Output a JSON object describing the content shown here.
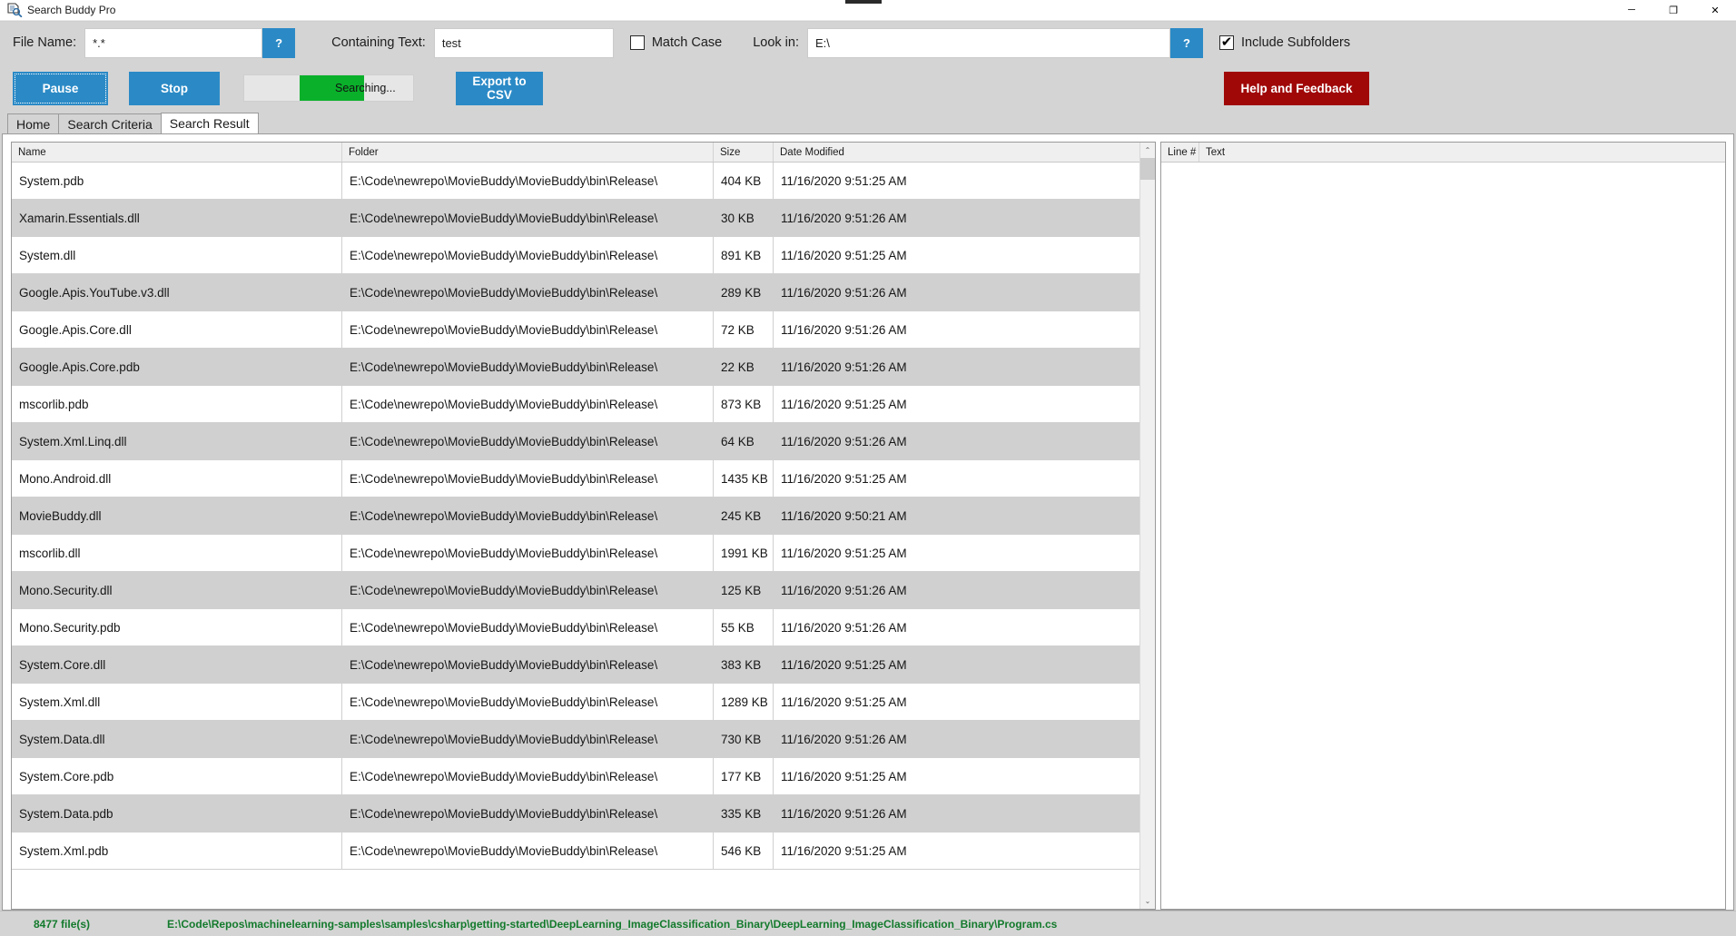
{
  "window": {
    "title": "Search Buddy Pro",
    "icon": "document-search-icon",
    "minimize_label": "─",
    "restore_label": "❐",
    "close_label": "✕"
  },
  "criteria": {
    "file_name_label": "File Name:",
    "file_name_value": "*.*",
    "file_name_help": "?",
    "containing_text_label": "Containing Text:",
    "containing_text_value": "test",
    "match_case_label": "Match Case",
    "match_case_checked": false,
    "look_in_label": "Look in:",
    "look_in_value": "E:\\",
    "look_in_help": "?",
    "include_subfolders_label": "Include Subfolders",
    "include_subfolders_checked": true,
    "checkmark": "✔"
  },
  "actions": {
    "pause_label": "Pause",
    "stop_label": "Stop",
    "export_label": "Export to CSV",
    "help_label": "Help and Feedback",
    "progress_text": "Searching...",
    "progress_percent": 38
  },
  "tabs": [
    {
      "label": "Home",
      "active": false
    },
    {
      "label": "Search Criteria",
      "active": false
    },
    {
      "label": "Search Result",
      "active": true
    }
  ],
  "results": {
    "columns": [
      "Name",
      "Folder",
      "Size",
      "Date Modified"
    ],
    "rows": [
      {
        "name": "System.pdb",
        "folder": "E:\\Code\\newrepo\\MovieBuddy\\MovieBuddy\\bin\\Release\\",
        "size": "404 KB",
        "date": "11/16/2020 9:51:25 AM"
      },
      {
        "name": "Xamarin.Essentials.dll",
        "folder": "E:\\Code\\newrepo\\MovieBuddy\\MovieBuddy\\bin\\Release\\",
        "size": "30 KB",
        "date": "11/16/2020 9:51:26 AM"
      },
      {
        "name": "System.dll",
        "folder": "E:\\Code\\newrepo\\MovieBuddy\\MovieBuddy\\bin\\Release\\",
        "size": "891 KB",
        "date": "11/16/2020 9:51:25 AM"
      },
      {
        "name": "Google.Apis.YouTube.v3.dll",
        "folder": "E:\\Code\\newrepo\\MovieBuddy\\MovieBuddy\\bin\\Release\\",
        "size": "289 KB",
        "date": "11/16/2020 9:51:26 AM"
      },
      {
        "name": "Google.Apis.Core.dll",
        "folder": "E:\\Code\\newrepo\\MovieBuddy\\MovieBuddy\\bin\\Release\\",
        "size": "72 KB",
        "date": "11/16/2020 9:51:26 AM"
      },
      {
        "name": "Google.Apis.Core.pdb",
        "folder": "E:\\Code\\newrepo\\MovieBuddy\\MovieBuddy\\bin\\Release\\",
        "size": "22 KB",
        "date": "11/16/2020 9:51:26 AM"
      },
      {
        "name": "mscorlib.pdb",
        "folder": "E:\\Code\\newrepo\\MovieBuddy\\MovieBuddy\\bin\\Release\\",
        "size": "873 KB",
        "date": "11/16/2020 9:51:25 AM"
      },
      {
        "name": "System.Xml.Linq.dll",
        "folder": "E:\\Code\\newrepo\\MovieBuddy\\MovieBuddy\\bin\\Release\\",
        "size": "64 KB",
        "date": "11/16/2020 9:51:26 AM"
      },
      {
        "name": "Mono.Android.dll",
        "folder": "E:\\Code\\newrepo\\MovieBuddy\\MovieBuddy\\bin\\Release\\",
        "size": "1435 KB",
        "date": "11/16/2020 9:51:25 AM"
      },
      {
        "name": "MovieBuddy.dll",
        "folder": "E:\\Code\\newrepo\\MovieBuddy\\MovieBuddy\\bin\\Release\\",
        "size": "245 KB",
        "date": "11/16/2020 9:50:21 AM"
      },
      {
        "name": "mscorlib.dll",
        "folder": "E:\\Code\\newrepo\\MovieBuddy\\MovieBuddy\\bin\\Release\\",
        "size": "1991 KB",
        "date": "11/16/2020 9:51:25 AM"
      },
      {
        "name": "Mono.Security.dll",
        "folder": "E:\\Code\\newrepo\\MovieBuddy\\MovieBuddy\\bin\\Release\\",
        "size": "125 KB",
        "date": "11/16/2020 9:51:26 AM"
      },
      {
        "name": "Mono.Security.pdb",
        "folder": "E:\\Code\\newrepo\\MovieBuddy\\MovieBuddy\\bin\\Release\\",
        "size": "55 KB",
        "date": "11/16/2020 9:51:26 AM"
      },
      {
        "name": "System.Core.dll",
        "folder": "E:\\Code\\newrepo\\MovieBuddy\\MovieBuddy\\bin\\Release\\",
        "size": "383 KB",
        "date": "11/16/2020 9:51:25 AM"
      },
      {
        "name": "System.Xml.dll",
        "folder": "E:\\Code\\newrepo\\MovieBuddy\\MovieBuddy\\bin\\Release\\",
        "size": "1289 KB",
        "date": "11/16/2020 9:51:25 AM"
      },
      {
        "name": "System.Data.dll",
        "folder": "E:\\Code\\newrepo\\MovieBuddy\\MovieBuddy\\bin\\Release\\",
        "size": "730 KB",
        "date": "11/16/2020 9:51:26 AM"
      },
      {
        "name": "System.Core.pdb",
        "folder": "E:\\Code\\newrepo\\MovieBuddy\\MovieBuddy\\bin\\Release\\",
        "size": "177 KB",
        "date": "11/16/2020 9:51:25 AM"
      },
      {
        "name": "System.Data.pdb",
        "folder": "E:\\Code\\newrepo\\MovieBuddy\\MovieBuddy\\bin\\Release\\",
        "size": "335 KB",
        "date": "11/16/2020 9:51:26 AM"
      },
      {
        "name": "System.Xml.pdb",
        "folder": "E:\\Code\\newrepo\\MovieBuddy\\MovieBuddy\\bin\\Release\\",
        "size": "546 KB",
        "date": "11/16/2020 9:51:25 AM"
      }
    ],
    "scroll_up_icon": "⌃",
    "scroll_down_icon": "⌄"
  },
  "preview": {
    "columns": [
      "Line #",
      "Text"
    ],
    "rows": []
  },
  "status": {
    "file_count": "8477 file(s)",
    "current_path": "E:\\Code\\Repos\\machinelearning-samples\\samples\\csharp\\getting-started\\DeepLearning_ImageClassification_Binary\\DeepLearning_ImageClassification_Binary\\Program.cs"
  },
  "colors": {
    "accent_blue": "#2b8ac6",
    "danger_red": "#a00808",
    "progress_green": "#0ab02a",
    "status_green": "#137a2c",
    "window_chrome": "#d4d4d4"
  }
}
